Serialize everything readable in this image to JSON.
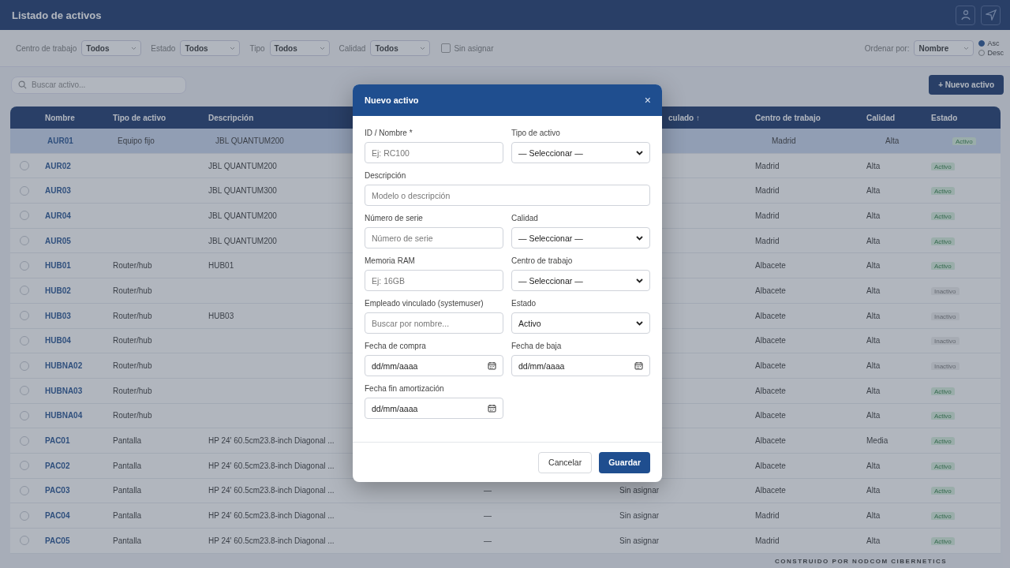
{
  "app_bar": {
    "title": "Listado de activos"
  },
  "filters": [
    {
      "label": "Centro de trabajo",
      "value": "Todos"
    },
    {
      "label": "Estado",
      "value": "Todos"
    },
    {
      "label": "Tipo",
      "value": "Todos"
    },
    {
      "label": "Calidad",
      "value": "Todos"
    }
  ],
  "unassigned_filter": {
    "label": "Sin asignar",
    "checked": false
  },
  "sort": {
    "label": "Ordenar por:",
    "value": "Nombre",
    "directions": [
      {
        "label": "Asc",
        "selected": true
      },
      {
        "label": "Desc",
        "selected": false
      }
    ]
  },
  "search": {
    "placeholder": "Buscar activo..."
  },
  "new_button": "+ Nuevo activo",
  "table": {
    "columns": [
      "Nombre",
      "Tipo de activo",
      "Descripción",
      "",
      "",
      "culado ↑",
      "Centro de trabajo",
      "Calidad",
      "Estado"
    ],
    "rows": [
      {
        "selected": true,
        "name": "AUR01",
        "type": "Equipo fijo",
        "description": "JBL QUANTUM200",
        "column_5": "",
        "column_6": "",
        "center": "Madrid",
        "quality": "Alta",
        "status": "Activo",
        "active": true
      },
      {
        "selected": false,
        "name": "AUR02",
        "type": "",
        "description": "JBL QUANTUM200",
        "column_5": "",
        "column_6": "",
        "center": "Madrid",
        "quality": "Alta",
        "status": "Activo",
        "active": true
      },
      {
        "selected": false,
        "name": "AUR03",
        "type": "",
        "description": "JBL QUANTUM300",
        "column_5": "",
        "column_6": "",
        "center": "Madrid",
        "quality": "Alta",
        "status": "Activo",
        "active": true
      },
      {
        "selected": false,
        "name": "AUR04",
        "type": "",
        "description": "JBL QUANTUM200",
        "column_5": "",
        "column_6": "",
        "center": "Madrid",
        "quality": "Alta",
        "status": "Activo",
        "active": true
      },
      {
        "selected": false,
        "name": "AUR05",
        "type": "",
        "description": "JBL QUANTUM200",
        "column_5": "",
        "column_6": "",
        "center": "Madrid",
        "quality": "Alta",
        "status": "Activo",
        "active": true
      },
      {
        "selected": false,
        "name": "HUB01",
        "type": "Router/hub",
        "description": "HUB01",
        "column_5": "",
        "column_6": "",
        "center": "Albacete",
        "quality": "Alta",
        "status": "Activo",
        "active": true
      },
      {
        "selected": false,
        "name": "HUB02",
        "type": "Router/hub",
        "description": "",
        "column_5": "",
        "column_6": "",
        "center": "Albacete",
        "quality": "Alta",
        "status": "Inactivo",
        "active": false
      },
      {
        "selected": false,
        "name": "HUB03",
        "type": "Router/hub",
        "description": "HUB03",
        "column_5": "",
        "column_6": "",
        "center": "Albacete",
        "quality": "Alta",
        "status": "Inactivo",
        "active": false
      },
      {
        "selected": false,
        "name": "HUB04",
        "type": "Router/hub",
        "description": "",
        "column_5": "",
        "column_6": "",
        "center": "Albacete",
        "quality": "Alta",
        "status": "Inactivo",
        "active": false
      },
      {
        "selected": false,
        "name": "HUBNA02",
        "type": "Router/hub",
        "description": "",
        "column_5": "",
        "column_6": "",
        "center": "Albacete",
        "quality": "Alta",
        "status": "Inactivo",
        "active": false
      },
      {
        "selected": false,
        "name": "HUBNA03",
        "type": "Router/hub",
        "description": "",
        "column_5": "",
        "column_6": "",
        "center": "Albacete",
        "quality": "Alta",
        "status": "Activo",
        "active": true
      },
      {
        "selected": false,
        "name": "HUBNA04",
        "type": "Router/hub",
        "description": "",
        "column_5": "",
        "column_6": "",
        "center": "Albacete",
        "quality": "Alta",
        "status": "Activo",
        "active": true
      },
      {
        "selected": false,
        "name": "PAC01",
        "type": "Pantalla",
        "description": "HP 24' 60.5cm23.8-inch Diagonal ...",
        "column_5": "",
        "column_6": "",
        "center": "Albacete",
        "quality": "Media",
        "status": "Activo",
        "active": true
      },
      {
        "selected": false,
        "name": "PAC02",
        "type": "Pantalla",
        "description": "HP 24' 60.5cm23.8-inch Diagonal ...",
        "column_5": "",
        "column_6": "",
        "center": "Albacete",
        "quality": "Alta",
        "status": "Activo",
        "active": true
      },
      {
        "selected": false,
        "name": "PAC03",
        "type": "Pantalla",
        "description": "HP 24' 60.5cm23.8-inch Diagonal ...",
        "column_5": "—",
        "column_6": "Sin asignar",
        "center": "Albacete",
        "quality": "Alta",
        "status": "Activo",
        "active": true
      },
      {
        "selected": false,
        "name": "PAC04",
        "type": "Pantalla",
        "description": "HP 24' 60.5cm23.8-inch Diagonal ...",
        "column_5": "—",
        "column_6": "Sin asignar",
        "center": "Madrid",
        "quality": "Alta",
        "status": "Activo",
        "active": true
      },
      {
        "selected": false,
        "name": "PAC05",
        "type": "Pantalla",
        "description": "HP 24' 60.5cm23.8-inch Diagonal ...",
        "column_5": "—",
        "column_6": "Sin asignar",
        "center": "Madrid",
        "quality": "Alta",
        "status": "Activo",
        "active": true
      }
    ]
  },
  "footer": "CONSTRUIDO POR NODCOM CIBERNETICS",
  "dialog": {
    "title": "Nuevo activo",
    "close": "×",
    "fields": [
      {
        "kind": "input",
        "label": "ID / Nombre *",
        "placeholder": "Ej: RC100",
        "wide": false
      },
      {
        "kind": "select",
        "label": "Tipo de activo",
        "value": "— Seleccionar —",
        "wide": false
      },
      {
        "kind": "input",
        "label": "Descripción",
        "placeholder": "Modelo o descripción",
        "wide": true
      },
      {
        "kind": "input",
        "label": "Número de serie",
        "placeholder": "Número de serie",
        "wide": false
      },
      {
        "kind": "select",
        "label": "Calidad",
        "value": "— Seleccionar —",
        "wide": false
      },
      {
        "kind": "input",
        "label": "Memoria RAM",
        "placeholder": "Ej: 16GB",
        "wide": false
      },
      {
        "kind": "select",
        "label": "Centro de trabajo",
        "value": "— Seleccionar —",
        "wide": false
      },
      {
        "kind": "input",
        "label": "Empleado vinculado (systemuser)",
        "placeholder": "Buscar por nombre...",
        "wide": false
      },
      {
        "kind": "select",
        "label": "Estado",
        "value": "Activo",
        "wide": false
      },
      {
        "kind": "date",
        "label": "Fecha de compra",
        "placeholder": "dd/mm/aaaa",
        "wide": false
      },
      {
        "kind": "date",
        "label": "Fecha de baja",
        "placeholder": "dd/mm/aaaa",
        "wide": false
      },
      {
        "kind": "date",
        "label": "Fecha fin amortización",
        "placeholder": "dd/mm/aaaa",
        "wide": false
      }
    ],
    "buttons": [
      {
        "label": "Cancelar",
        "primary": false
      },
      {
        "label": "Guardar",
        "primary": true
      }
    ]
  }
}
